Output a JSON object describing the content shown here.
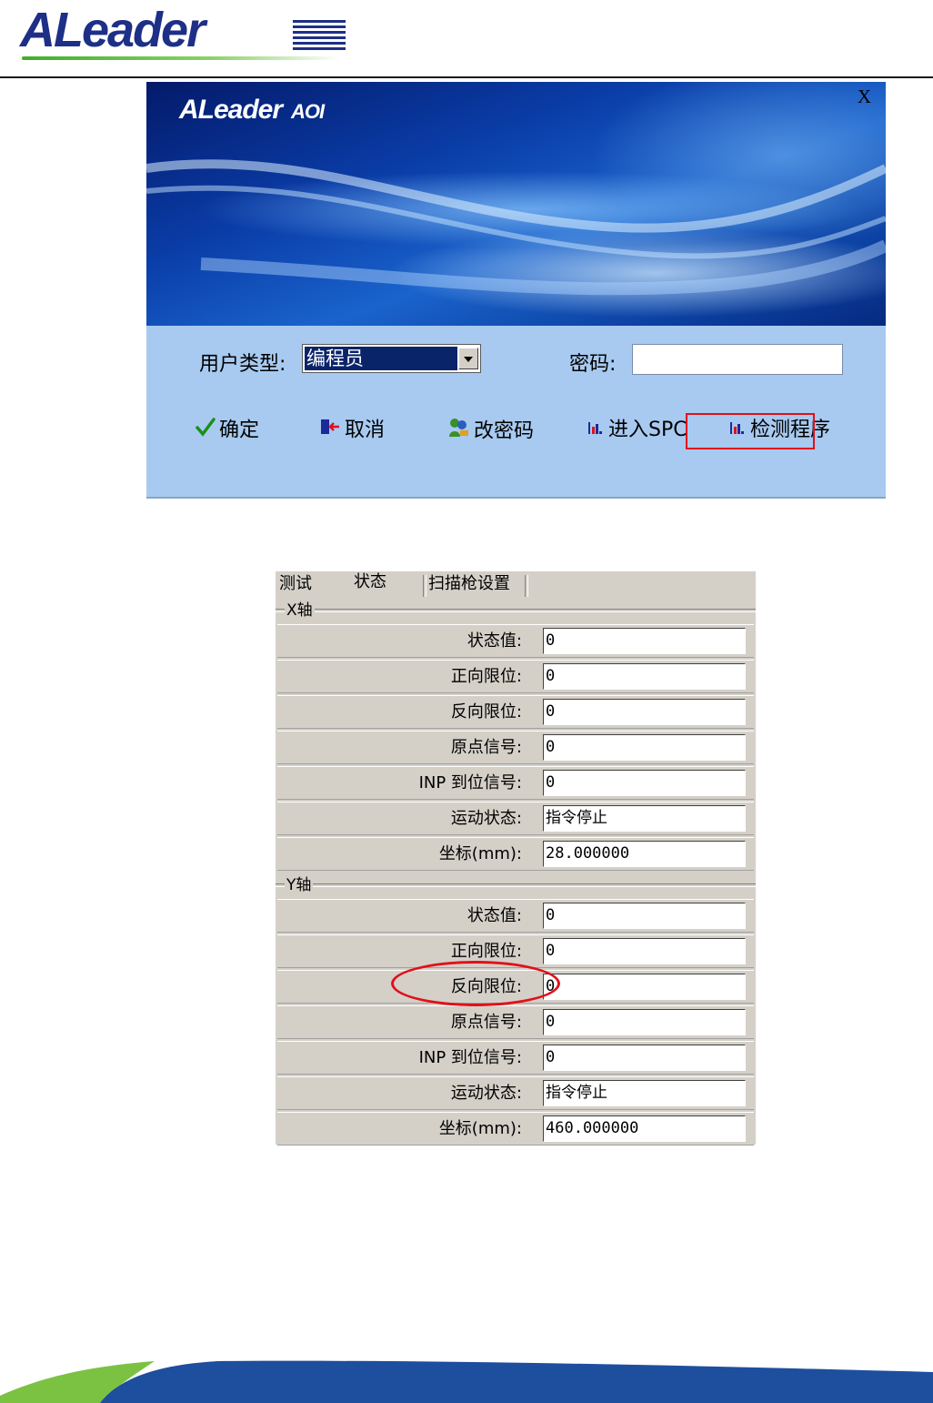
{
  "header": {
    "logo_text": "ALeader"
  },
  "login_dialog": {
    "banner_logo": "ALeader",
    "banner_suffix": "AOI",
    "close_label": "X",
    "user_type_label": "用户类型:",
    "user_type_value": "编程员",
    "password_label": "密码:",
    "password_value": "",
    "buttons": {
      "ok": "确定",
      "cancel": "取消",
      "change_password": "改密码",
      "enter_spc": "进入SPC",
      "detection_program": "检测程序"
    }
  },
  "status_panel": {
    "tabs": [
      "测试",
      "状态",
      "扫描枪设置"
    ],
    "x_axis": {
      "title": "X轴",
      "rows": [
        {
          "label": "状态值:",
          "value": "0"
        },
        {
          "label": "正向限位:",
          "value": "0"
        },
        {
          "label": "反向限位:",
          "value": "0"
        },
        {
          "label": "原点信号:",
          "value": "0"
        },
        {
          "label": "INP 到位信号:",
          "value": "0"
        },
        {
          "label": "运动状态:",
          "value": "指令停止"
        },
        {
          "label": "坐标(mm):",
          "value": "28.000000"
        }
      ]
    },
    "y_axis": {
      "title": "Y轴",
      "rows": [
        {
          "label": "状态值:",
          "value": "0"
        },
        {
          "label": "正向限位:",
          "value": "0"
        },
        {
          "label": "反向限位:",
          "value": "0"
        },
        {
          "label": "原点信号:",
          "value": "0"
        },
        {
          "label": "INP 到位信号:",
          "value": "0"
        },
        {
          "label": "运动状态:",
          "value": "指令停止"
        },
        {
          "label": "坐标(mm):",
          "value": "460.000000"
        }
      ]
    }
  },
  "colors": {
    "brand_blue": "#1d2f86",
    "brand_green": "#3fae2a",
    "highlight_red": "#e0101a",
    "panel_blue": "#a8caf0",
    "dialog_gray": "#d4d0c8"
  },
  "icons": [
    "check-icon",
    "exit-door-icon",
    "users-key-icon",
    "bar-chart-icon",
    "bar-chart-icon"
  ]
}
